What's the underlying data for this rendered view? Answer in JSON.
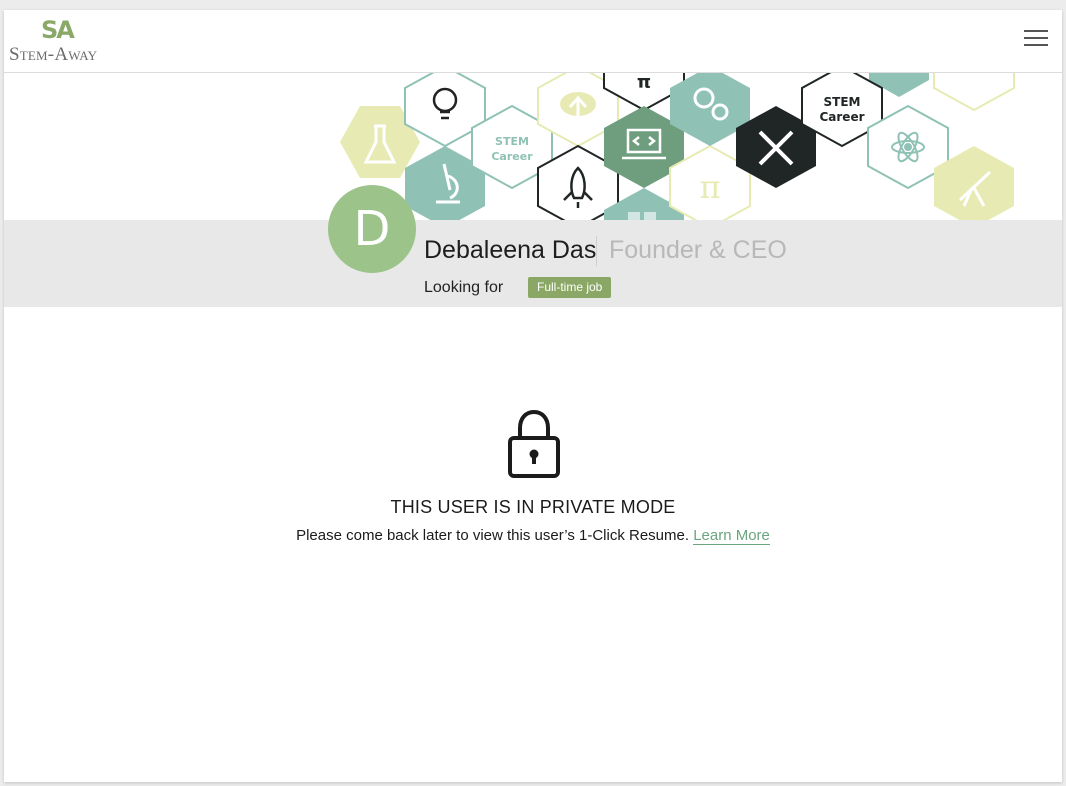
{
  "header": {
    "logo_mark": "SA",
    "logo_text": "Stem-Away",
    "menu_icon": "hamburger-menu-icon"
  },
  "banner": {
    "hex_labels": [
      "STEM",
      "Career",
      "STEM",
      "Career",
      "π"
    ],
    "icons": [
      "flask-icon",
      "lightbulb-icon",
      "microscope-icon",
      "cloud-upload-icon",
      "rocket-icon",
      "laptop-code-icon",
      "gears-icon",
      "tools-icon",
      "atom-icon",
      "telescope-icon",
      "calculator-icon"
    ]
  },
  "profile": {
    "avatar_initial": "D",
    "name": "Debaleena Das",
    "role": "Founder & CEO",
    "looking_for_label": "Looking for",
    "job_badge": "Full-time job"
  },
  "private": {
    "lock_icon": "lock-icon",
    "title": "THIS USER IS IN PRIVATE MODE",
    "message": "Please come back later to view this user’s  1-Click Resume.",
    "learn_more": "Learn More"
  },
  "colors": {
    "brand_green": "#8ba766",
    "avatar_green": "#9cc48a",
    "link_green": "#6ba57f",
    "teal": "#8fc2b5",
    "yellow": "#e7ebb3",
    "dark_green": "#6f9e7f",
    "dark": "#202526"
  }
}
